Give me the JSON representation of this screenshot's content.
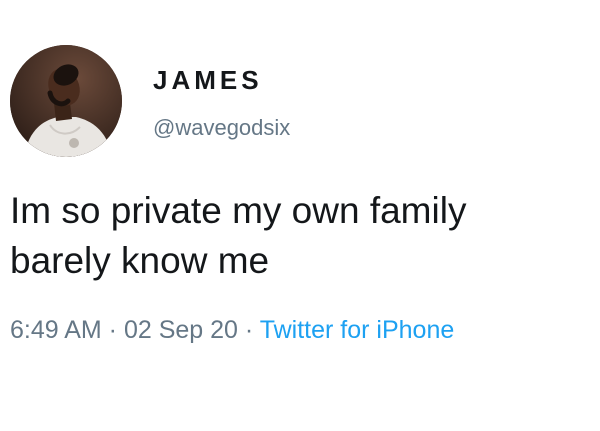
{
  "tweet": {
    "author": {
      "display_name": "JAMES",
      "handle": "@wavegodsix",
      "avatar_icon": "user-avatar-photo"
    },
    "text_line_1": "Im so private my own family",
    "text_line_2": "barely know me",
    "meta": {
      "time": "6:49 AM",
      "separator": " · ",
      "date": "02 Sep 20",
      "source": "Twitter for iPhone"
    }
  },
  "colors": {
    "text_primary": "#14171a",
    "text_secondary": "#657786",
    "link": "#1da1f2",
    "background": "#ffffff"
  }
}
